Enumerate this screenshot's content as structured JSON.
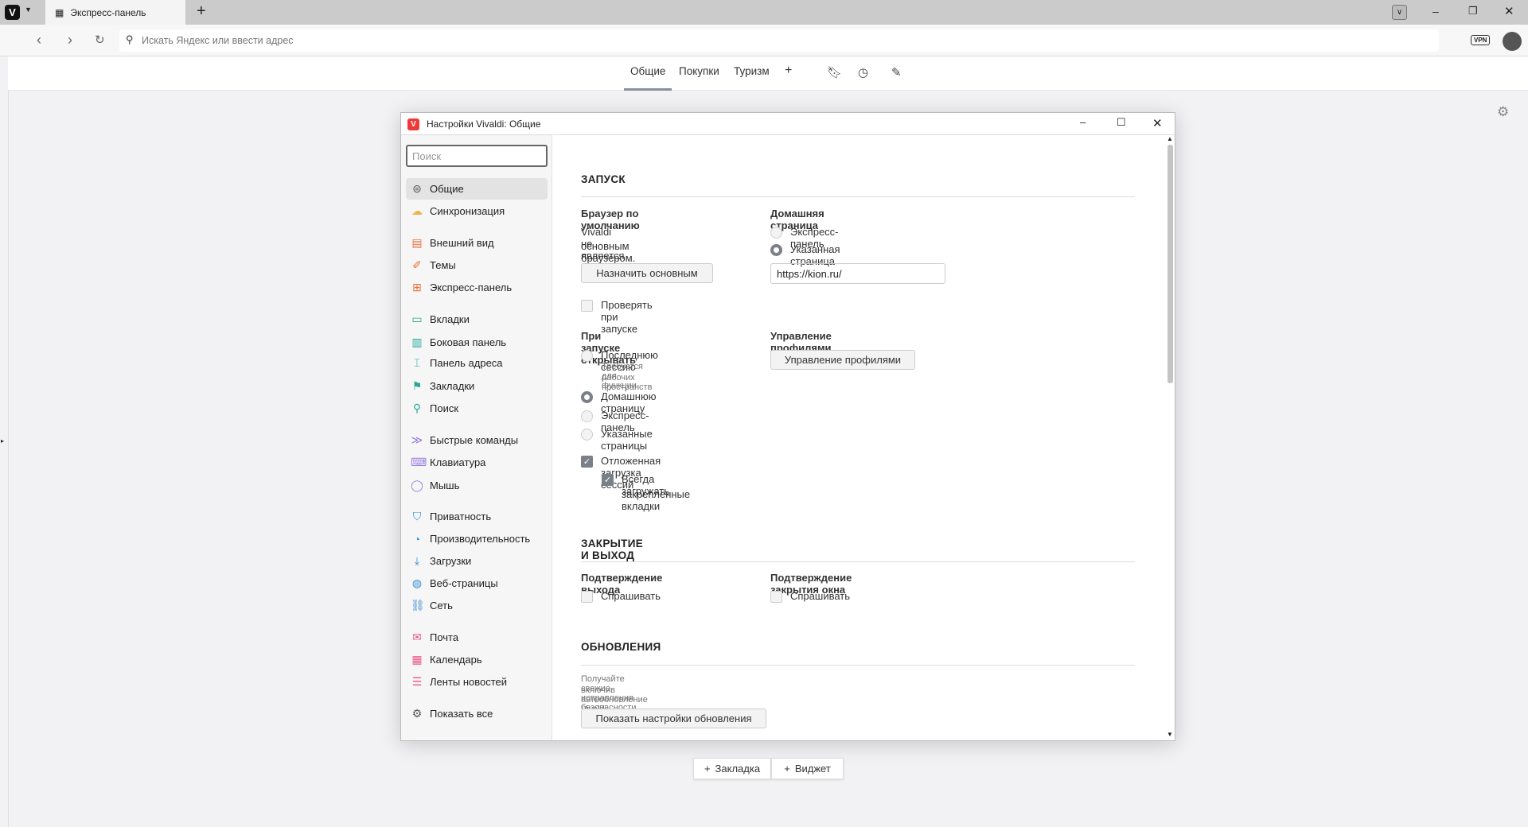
{
  "browser": {
    "tab_title": "Экспресс-панель",
    "address_placeholder": "Искать Яндекс или ввести адрес",
    "vpn": "VPN"
  },
  "speed_dial": {
    "groups": [
      "Общие",
      "Покупки",
      "Туризм"
    ],
    "add": "+",
    "add_bookmark": "Закладка",
    "add_widget": "Виджет"
  },
  "dialog": {
    "title": "Настройки Vivaldi: Общие",
    "search_placeholder": "Поиск",
    "sidebar": [
      {
        "label": "Общие",
        "icon": "general-icon",
        "color": "#555"
      },
      {
        "label": "Синхронизация",
        "icon": "cloud-icon",
        "color": "#f0b34a"
      },
      {
        "label": "Внешний вид",
        "icon": "appearance-icon",
        "color": "#e8703a"
      },
      {
        "label": "Темы",
        "icon": "brush-icon",
        "color": "#e8703a"
      },
      {
        "label": "Экспресс-панель",
        "icon": "speed-dial-icon",
        "color": "#e8703a"
      },
      {
        "label": "Вкладки",
        "icon": "tabs-icon",
        "color": "#2aa89a"
      },
      {
        "label": "Боковая панель",
        "icon": "panel-icon",
        "color": "#2aa89a"
      },
      {
        "label": "Панель адреса",
        "icon": "address-bar-icon",
        "color": "#2aa89a"
      },
      {
        "label": "Закладки",
        "icon": "bookmark-icon",
        "color": "#2aa89a"
      },
      {
        "label": "Поиск",
        "icon": "search-icon",
        "color": "#2aa89a"
      },
      {
        "label": "Быстрые команды",
        "icon": "quick-commands-icon",
        "color": "#9a7de0"
      },
      {
        "label": "Клавиатура",
        "icon": "keyboard-icon",
        "color": "#9a7de0"
      },
      {
        "label": "Мышь",
        "icon": "mouse-icon",
        "color": "#9a7de0"
      },
      {
        "label": "Приватность",
        "icon": "shield-icon",
        "color": "#3b8fd8"
      },
      {
        "label": "Производительность",
        "icon": "gauge-icon",
        "color": "#3b8fd8"
      },
      {
        "label": "Загрузки",
        "icon": "download-icon",
        "color": "#3b8fd8"
      },
      {
        "label": "Веб-страницы",
        "icon": "globe-icon",
        "color": "#3b8fd8"
      },
      {
        "label": "Сеть",
        "icon": "network-icon",
        "color": "#3b8fd8"
      },
      {
        "label": "Почта",
        "icon": "mail-icon",
        "color": "#e8588a"
      },
      {
        "label": "Календарь",
        "icon": "calendar-icon",
        "color": "#e8588a"
      },
      {
        "label": "Ленты новостей",
        "icon": "rss-icon",
        "color": "#e8588a"
      },
      {
        "label": "Показать все",
        "icon": "gear-icon",
        "color": "#555"
      }
    ],
    "startup": {
      "heading": "ЗАПУСК",
      "default_browser_label": "Браузер по умолчанию",
      "default_browser_text1": "Vivaldi не является вашим",
      "default_browser_text2": "основным браузером.",
      "set_default": "Назначить основным",
      "check_on_start": "Проверять при запуске",
      "check_on_start_checked": false,
      "homepage_label": "Домашняя страница",
      "homepage_options": [
        "Экспресс-панель",
        "Указанная страница"
      ],
      "homepage_selected": 1,
      "homepage_url": "https://kion.ru/",
      "open_label": "При запуске открывать",
      "open_options": [
        "Последнюю сессию",
        "Домашнюю страницу",
        "Экспресс-панель",
        "Указанные страницы"
      ],
      "open_selected": 1,
      "last_session_note1": "Требуется для функции",
      "last_session_note2": "рабочих пространств",
      "lazy_load": "Отложенная загрузка сессий",
      "lazy_load_checked": true,
      "always_load_pinned1": "Всегда загружать",
      "always_load_pinned2": "закреплённые вкладки",
      "always_load_pinned_checked": true,
      "profiles_label": "Управление профилями",
      "profiles_button": "Управление профилями"
    },
    "close": {
      "heading": "ЗАКРЫТИЕ И ВЫХОД",
      "confirm_exit_label": "Подтверждение выхода",
      "confirm_exit_option": "Спрашивать",
      "confirm_window_label": "Подтверждение закрытия окна",
      "confirm_window_option": "Спрашивать"
    },
    "updates": {
      "heading": "ОБНОВЛЕНИЯ",
      "text1": "Получайте свежие исправления безопасности,",
      "text2": "включив автообновление Vivaldi.",
      "button": "Показать настройки обновления"
    }
  },
  "colors": {
    "vivaldi_red": "#ef3939",
    "accent": "#7a7f88"
  }
}
